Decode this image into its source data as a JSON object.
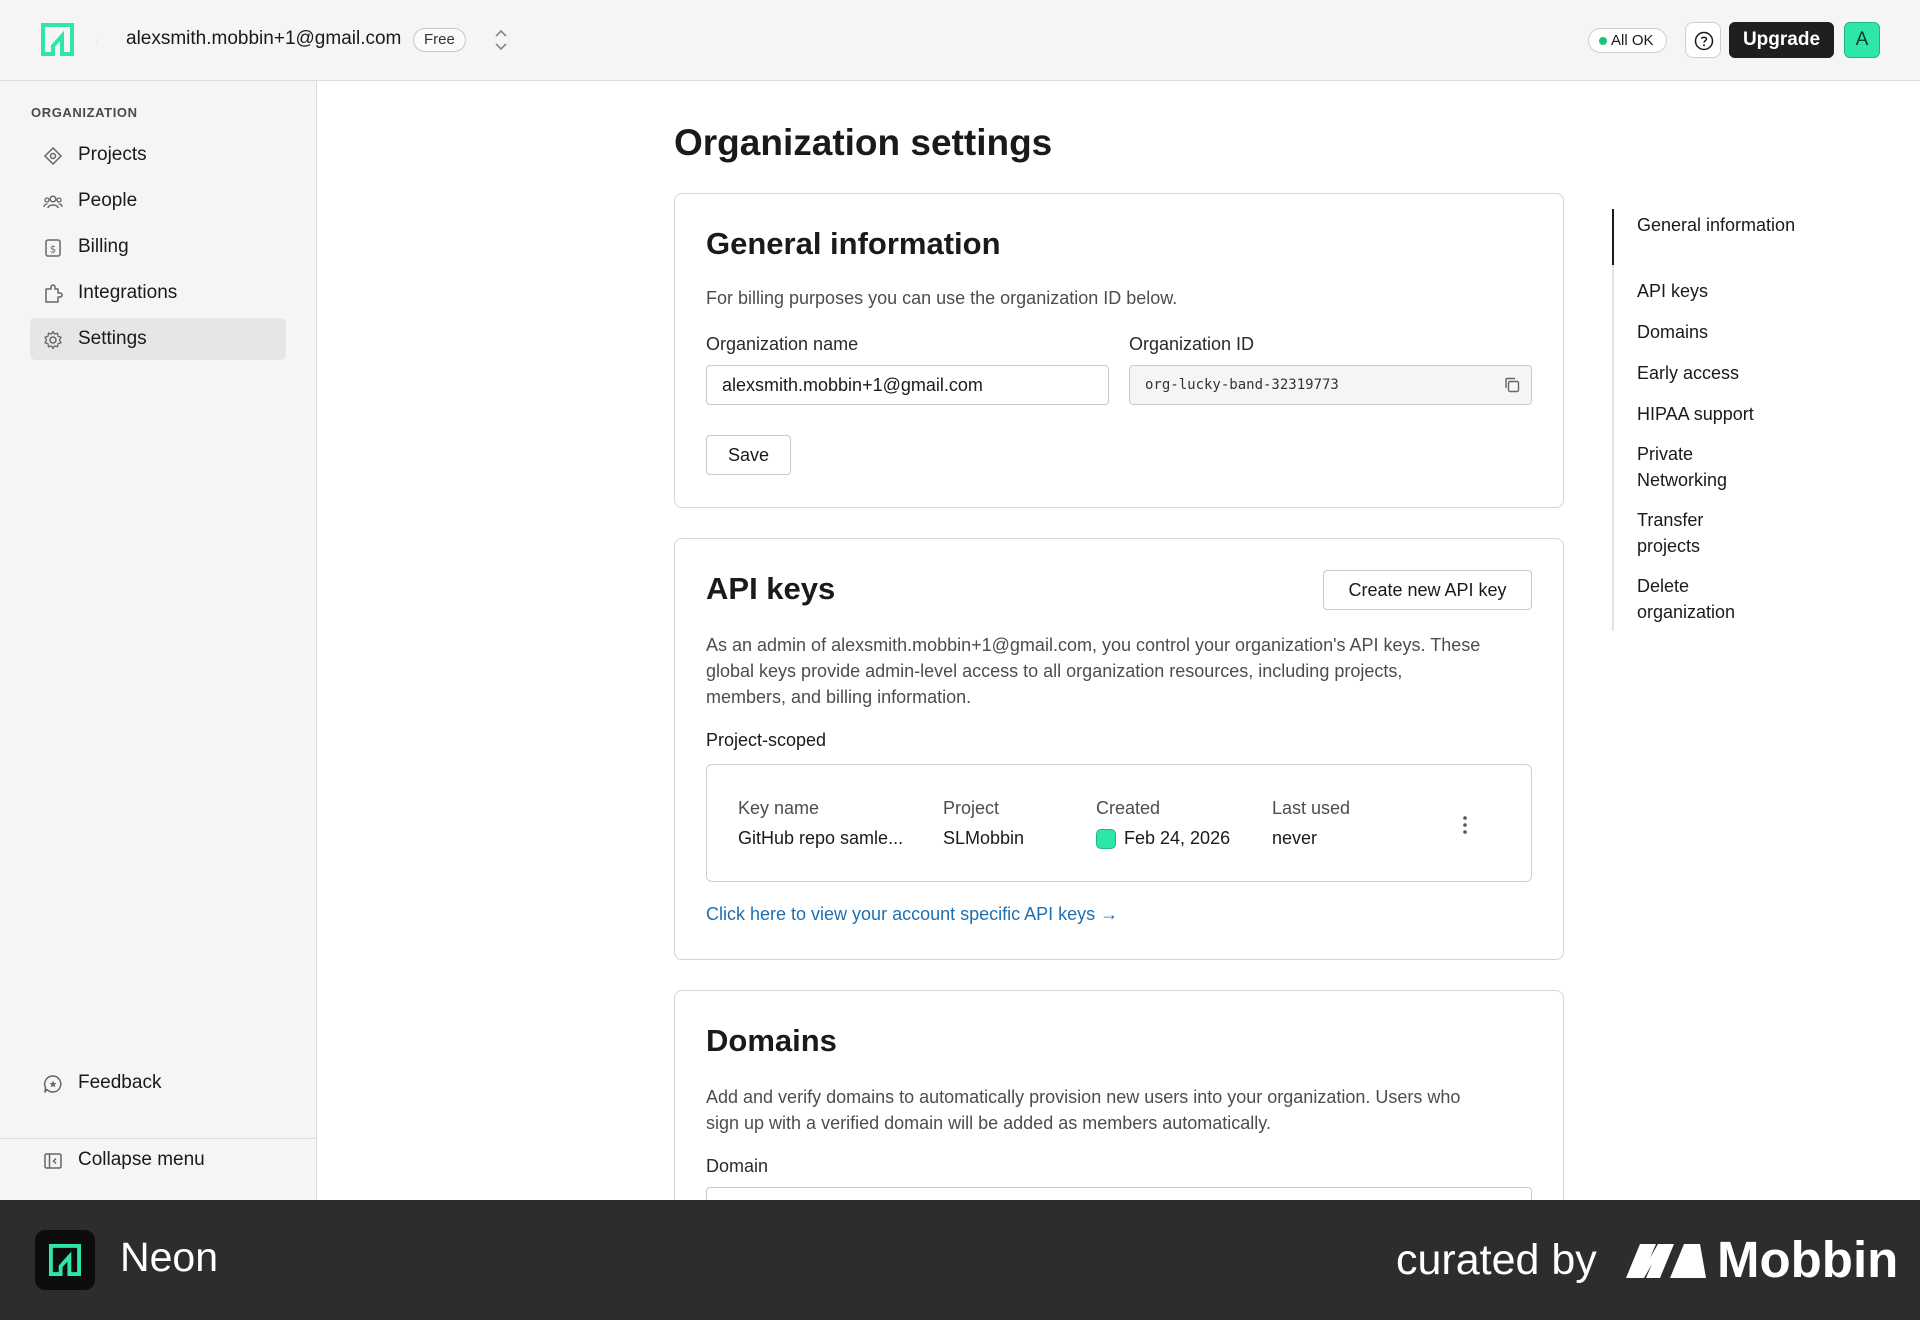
{
  "topbar": {
    "org_email": "alexsmith.mobbin+1@gmail.com",
    "plan_badge": "Free",
    "status": "All OK",
    "upgrade_label": "Upgrade",
    "avatar_initial": "A",
    "status_color": "#19c37d",
    "brand_color": "#2ee6a6"
  },
  "sidebar": {
    "heading": "ORGANIZATION",
    "items": [
      {
        "label": "Projects",
        "icon": "projects-icon"
      },
      {
        "label": "People",
        "icon": "people-icon"
      },
      {
        "label": "Billing",
        "icon": "billing-icon"
      },
      {
        "label": "Integrations",
        "icon": "integrations-icon"
      },
      {
        "label": "Settings",
        "icon": "gear-icon",
        "active": true
      }
    ],
    "feedback_label": "Feedback",
    "collapse_label": "Collapse menu"
  },
  "main": {
    "page_title": "Organization settings",
    "general": {
      "title": "General information",
      "description": "For billing purposes you can use the organization ID below.",
      "org_name_label": "Organization name",
      "org_name_value": "alexsmith.mobbin+1@gmail.com",
      "org_id_label": "Organization ID",
      "org_id_value": "org-lucky-band-32319773",
      "save_label": "Save"
    },
    "api_keys": {
      "title": "API keys",
      "create_label": "Create new API key",
      "description_line1": "As an admin of alexsmith.mobbin+1@gmail.com, you control your organization's API keys. These",
      "description_line2": "global keys provide admin-level access to all organization resources, including projects,",
      "description_line3": "members, and billing information.",
      "scope_heading": "Project-scoped",
      "columns": [
        "Key name",
        "Project",
        "Created",
        "Last used"
      ],
      "rows": [
        {
          "key_name": "GitHub repo samle...",
          "project": "SLMobbin",
          "created": "Feb 24, 2026",
          "last_used": "never"
        }
      ],
      "account_link": "Click here to view your account specific API keys →"
    },
    "domains": {
      "title": "Domains",
      "description_line1": "Add and verify domains to automatically provision new users into your organization. Users who",
      "description_line2": "sign up with a verified domain will be added as members automatically.",
      "domain_label": "Domain"
    }
  },
  "toc": {
    "items": [
      "General information",
      "API keys",
      "Domains",
      "Early access",
      "HIPAA support",
      "Private Networking",
      "Transfer projects",
      "Delete organization"
    ]
  },
  "banner": {
    "app_name": "Neon",
    "curated_by": "curated by",
    "brand": "Mobbin"
  }
}
